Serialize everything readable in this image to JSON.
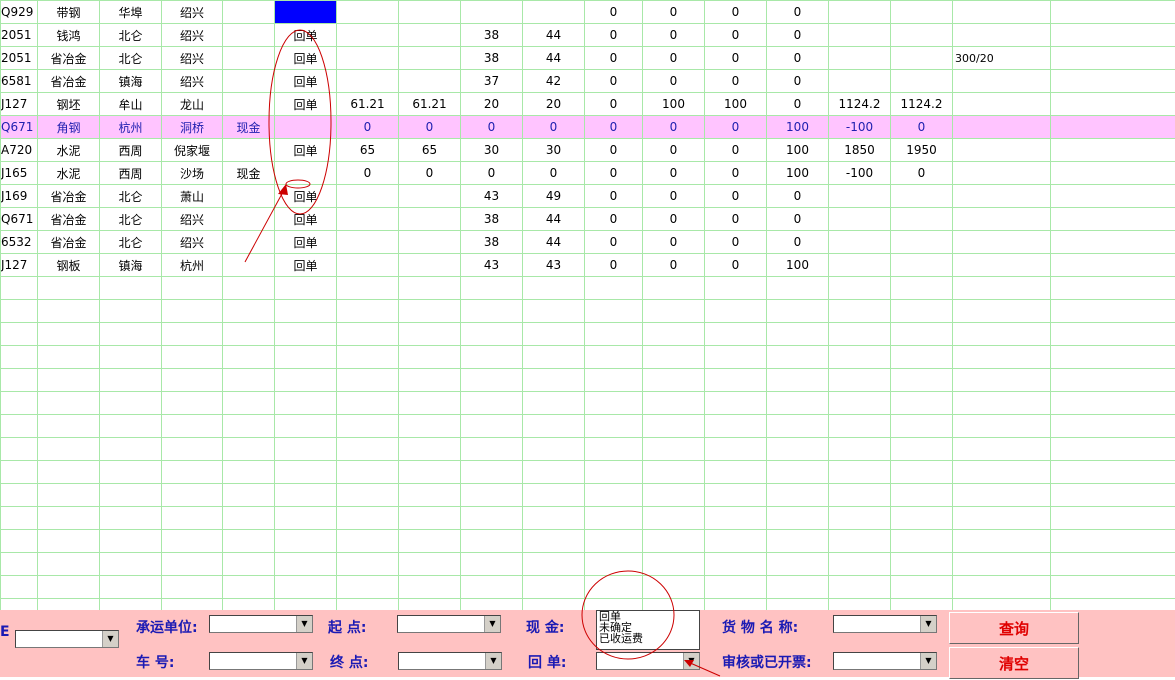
{
  "grid": {
    "rows": [
      {
        "cells": [
          "Q929",
          "带钢",
          "华埠",
          "绍兴",
          "",
          "",
          "",
          "",
          "",
          "",
          "0",
          "0",
          "0",
          "0",
          "",
          "",
          ""
        ],
        "highlight": false,
        "blue_col": 5
      },
      {
        "cells": [
          "2051",
          "钱鸿",
          "北仑",
          "绍兴",
          "",
          "回单",
          "",
          "",
          "38",
          "44",
          "0",
          "0",
          "0",
          "0",
          "",
          "",
          ""
        ],
        "highlight": false
      },
      {
        "cells": [
          "2051",
          "省冶金",
          "北仑",
          "绍兴",
          "",
          "回单",
          "",
          "",
          "38",
          "44",
          "0",
          "0",
          "0",
          "0",
          "",
          "",
          "300/20"
        ],
        "highlight": false
      },
      {
        "cells": [
          "6581",
          "省冶金",
          "镇海",
          "绍兴",
          "",
          "回单",
          "",
          "",
          "37",
          "42",
          "0",
          "0",
          "0",
          "0",
          "",
          "",
          ""
        ],
        "highlight": false
      },
      {
        "cells": [
          "J127",
          "钢坯",
          "牟山",
          "龙山",
          "",
          "回单",
          "61.21",
          "61.21",
          "20",
          "20",
          "0",
          "100",
          "100",
          "0",
          "1124.2",
          "1124.2",
          ""
        ],
        "highlight": false
      },
      {
        "cells": [
          "Q671",
          "角钢",
          "杭州",
          "洞桥",
          "现金",
          "",
          "0",
          "0",
          "0",
          "0",
          "0",
          "0",
          "0",
          "100",
          "-100",
          "0",
          ""
        ],
        "highlight": true
      },
      {
        "cells": [
          "A720",
          "水泥",
          "西周",
          "倪家堰",
          "",
          "回单",
          "65",
          "65",
          "30",
          "30",
          "0",
          "0",
          "0",
          "100",
          "1850",
          "1950",
          ""
        ],
        "highlight": false
      },
      {
        "cells": [
          "J165",
          "水泥",
          "西周",
          "沙场",
          "现金",
          "",
          "0",
          "0",
          "0",
          "0",
          "0",
          "0",
          "0",
          "100",
          "-100",
          "0",
          ""
        ],
        "highlight": false
      },
      {
        "cells": [
          "J169",
          "省冶金",
          "北仑",
          "萧山",
          "",
          "回单",
          "",
          "",
          "43",
          "49",
          "0",
          "0",
          "0",
          "0",
          "",
          "",
          ""
        ],
        "highlight": false
      },
      {
        "cells": [
          "Q671",
          "省冶金",
          "北仑",
          "绍兴",
          "",
          "回单",
          "",
          "",
          "38",
          "44",
          "0",
          "0",
          "0",
          "0",
          "",
          "",
          ""
        ],
        "highlight": false
      },
      {
        "cells": [
          "6532",
          "省冶金",
          "北仑",
          "绍兴",
          "",
          "回单",
          "",
          "",
          "38",
          "44",
          "0",
          "0",
          "0",
          "0",
          "",
          "",
          ""
        ],
        "highlight": false
      },
      {
        "cells": [
          "J127",
          "钢板",
          "镇海",
          "杭州",
          "",
          "回单",
          "",
          "",
          "43",
          "43",
          "0",
          "0",
          "0",
          "100",
          "",
          "",
          ""
        ],
        "highlight": false
      }
    ]
  },
  "filters": {
    "carrier_label": "承运单位:",
    "origin_label": "起 点:",
    "cash_label": "现 金:",
    "goods_label": "货 物 名 称:",
    "vehicle_label": "车 号:",
    "destination_label": "终 点:",
    "receipt_label": "回 单:",
    "audit_label": "审核或已开票:",
    "left_cut_label": "E",
    "receipt_options": [
      "回单",
      "未确定",
      "已收运费"
    ]
  },
  "buttons": {
    "query": "查询",
    "clear": "清空"
  },
  "colors": {
    "grid_line": "#a8e8a8",
    "highlight_row": "#ffc4ff",
    "selected_cell": "#0000ff",
    "panel_bg": "#ffc2c2",
    "label_text": "#1a1ab4",
    "button_text": "#e00000",
    "annotation": "#cc0000"
  }
}
